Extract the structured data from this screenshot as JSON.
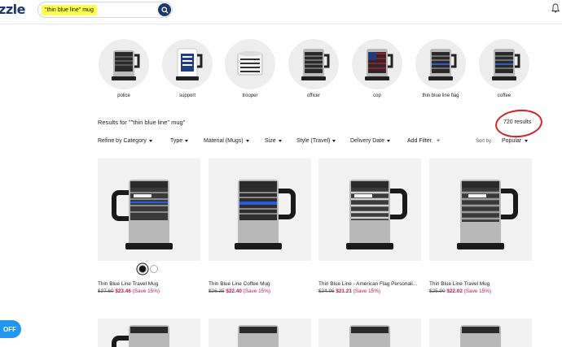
{
  "header": {
    "logo": "zzle",
    "search_value": "\"thin blue line\" mug"
  },
  "categories": [
    {
      "label": "police"
    },
    {
      "label": "support"
    },
    {
      "label": "trooper"
    },
    {
      "label": "officer"
    },
    {
      "label": "cop"
    },
    {
      "label": "thin blue line flag"
    },
    {
      "label": "coffee"
    }
  ],
  "results": {
    "title": "Results for \"\"thin blue line\" mug\"",
    "count": "720 results"
  },
  "filters": [
    {
      "label": "Refine by Category"
    },
    {
      "label": "Type"
    },
    {
      "label": "Material (Mugs)"
    },
    {
      "label": "Size"
    },
    {
      "label": "Style (Travel)"
    },
    {
      "label": "Delivery Date"
    },
    {
      "label": "Add Filter"
    }
  ],
  "add_filter_symbol": "+",
  "sort": {
    "label": "Sort by:",
    "value": "Popular"
  },
  "products": [
    {
      "title": "Thin Blue Line Travel Mug",
      "old_price": "$27.60",
      "new_price": "$23.46",
      "save": "(Save 15%)",
      "plaque": "YOUR NAME HERE"
    },
    {
      "title": "Thin Blue Line Coffee Mug",
      "old_price": "$26.35",
      "new_price": "$22.40",
      "save": "(Save 15%)",
      "plaque": ""
    },
    {
      "title": "Thin Blue Line - American Flag Personali...",
      "old_price": "$24.95",
      "new_price": "$21.21",
      "save": "(Save 15%)",
      "plaque": "YOUR NAME HERE"
    },
    {
      "title": "Thin Blue Line Travel Mug",
      "old_price": "$25.90",
      "new_price": "$22.02",
      "save": "(Save 15%)",
      "plaque": "YOUR NAME HERE"
    }
  ],
  "swatch_colors": [
    "#111111",
    "#ffffff"
  ],
  "promo_button": {
    "label": "OFF"
  },
  "colors": {
    "brand": "#1d3a6e",
    "sale": "#d11149",
    "highlight": "#ffff4d",
    "annotation": "#d61f26",
    "promo": "#2196f3"
  }
}
